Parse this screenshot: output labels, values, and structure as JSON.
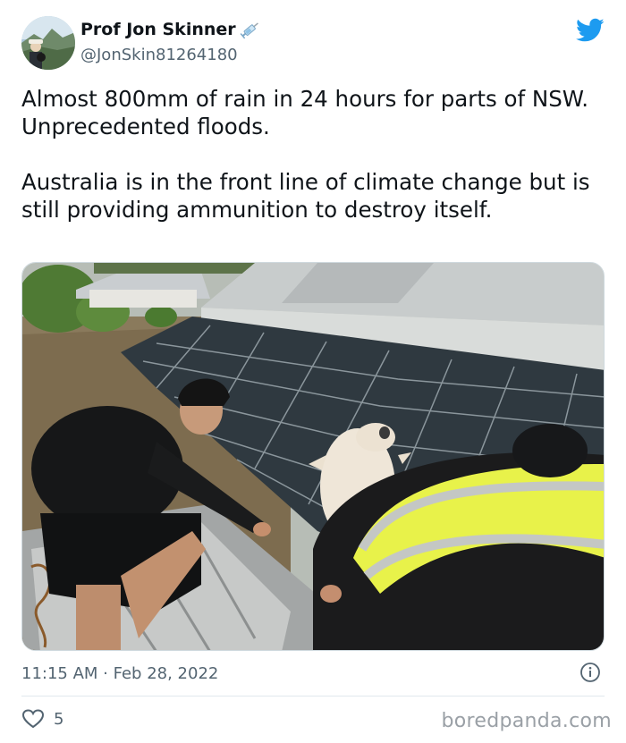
{
  "user": {
    "display_name": "Prof Jon Skinner",
    "handle": "@JonSkin81264180",
    "badge_icon": "syringe-icon"
  },
  "tweet": {
    "lines": [
      "Almost 800mm of rain in 24 hours for parts of NSW.",
      "Unprecedented floods.",
      "",
      "Australia is in the front line of climate change but is still providing ammunition to destroy itself."
    ],
    "timestamp": "11:15 AM · Feb 28, 2022",
    "like_count": "5"
  },
  "watermark": "boredpanda.com",
  "colors": {
    "twitter_blue": "#1d9bf0",
    "text_primary": "#0f1419",
    "text_secondary": "#536471",
    "divider": "#e1e8ed"
  }
}
